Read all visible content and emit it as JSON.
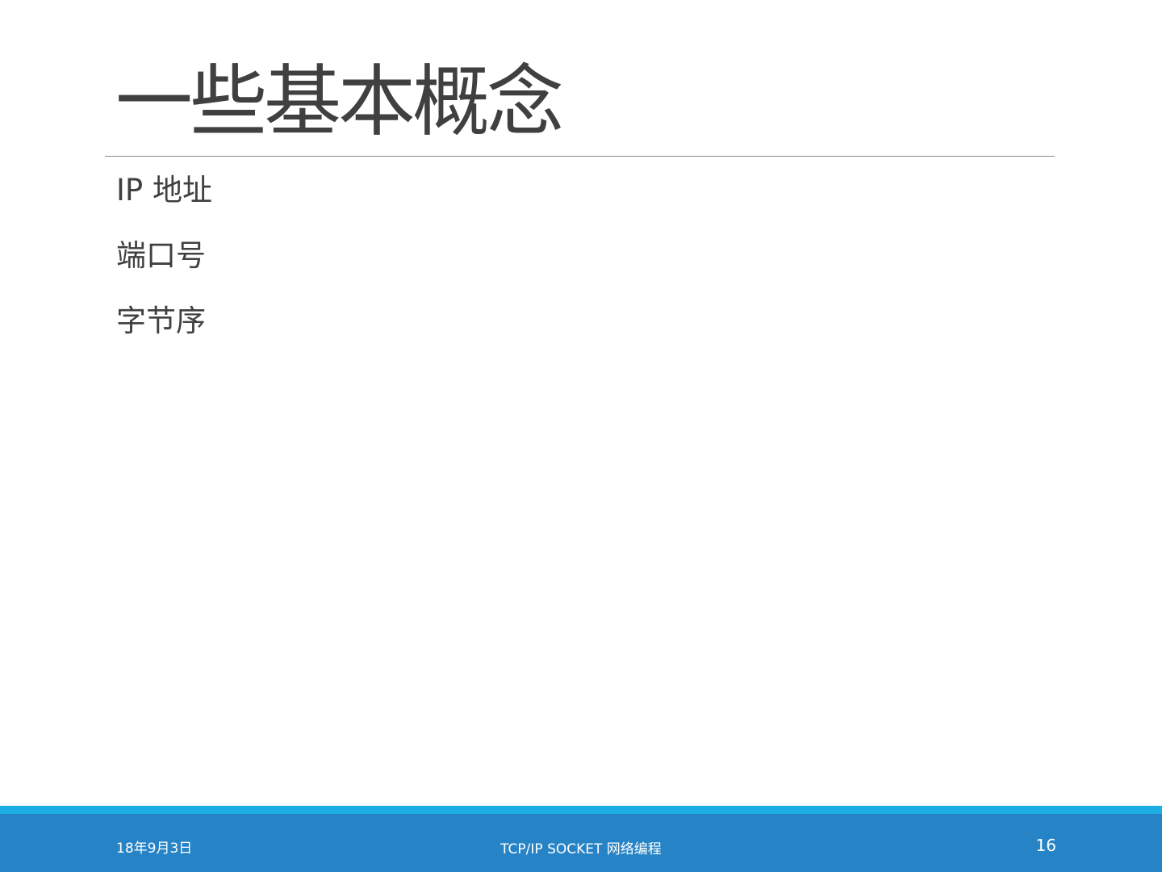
{
  "slide": {
    "title": "一些基本概念",
    "bullets": [
      "IP 地址",
      "端口号",
      "字节序"
    ]
  },
  "footer": {
    "date": "18年9月3日",
    "caption": "TCP/IP SOCKET 网络编程",
    "page_number": "16"
  },
  "colors": {
    "accent_light": "#1CADE4",
    "accent": "#2683C6",
    "text": "#404040"
  }
}
